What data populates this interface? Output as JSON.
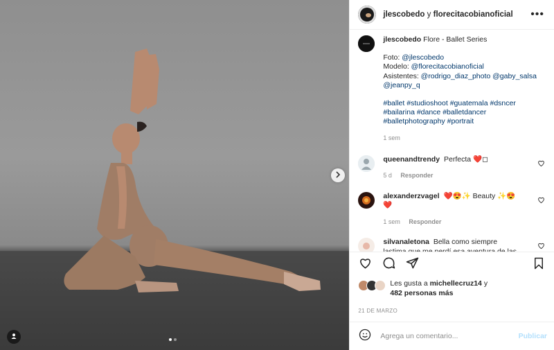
{
  "header": {
    "author": "jlescobedo",
    "connector": "y",
    "coauthor": "florecitacobianoficial",
    "more_icon": "more-horizontal-icon"
  },
  "caption": {
    "username": "jlescobedo",
    "title": "Flore - Ballet Series",
    "foto_label": "Foto:",
    "foto_link": "@jlescobedo",
    "modelo_label": "Modelo:",
    "modelo_link": "@florecitacobianoficial",
    "asist_label": "Asistentes:",
    "asist_link1": "@rodrigo_diaz_photo",
    "asist_link2": "@gaby_salsa",
    "asist_link3": "@jeanpy_q",
    "hashtags_line1": "#ballet #studioshoot #guatemala #dsncer",
    "hashtags_line2": "#bailarina #dance #balletdancer",
    "hashtags_line3": "#balletphotography #portrait",
    "time": "1 sem"
  },
  "comments": [
    {
      "username": "queenandtrendy",
      "text": "Perfecta ❤️◻",
      "time": "5 d",
      "reply": "Responder"
    },
    {
      "username": "alexanderzvagel",
      "text": "❤️😍✨ Beauty ✨😍❤️",
      "time": "1 sem",
      "reply": "Responder"
    },
    {
      "username": "silvanaletona",
      "text": "Bella como siempre lastima que me perdí esa aventura de las fotos"
    }
  ],
  "likes": {
    "prefix": "Les gusta a",
    "user": "michellecruz14",
    "suffix": "y",
    "others": "482 personas más"
  },
  "date": "21 DE MARZO",
  "add_comment": {
    "placeholder": "Agrega un comentario...",
    "publish": "Publicar"
  },
  "colors": {
    "link": "#00376b",
    "publish_disabled": "#b2dffc",
    "muted": "#8e8e8e"
  }
}
